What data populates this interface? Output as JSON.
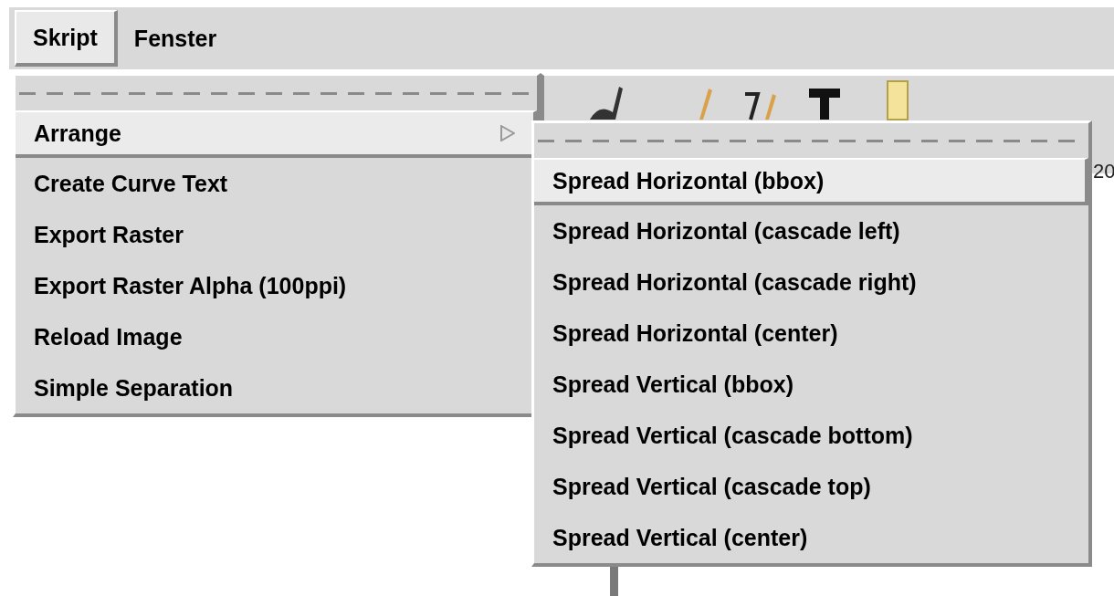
{
  "menubar": [
    {
      "label": "Skript",
      "selected": true
    },
    {
      "label": "Fenster",
      "selected": false
    }
  ],
  "menu": {
    "tear_off": true,
    "items": [
      {
        "label": "Arrange",
        "selected": true,
        "submenu": true
      },
      {
        "label": "Create Curve Text",
        "selected": false,
        "submenu": false
      },
      {
        "label": "Export Raster",
        "selected": false,
        "submenu": false
      },
      {
        "label": "Export Raster Alpha (100ppi)",
        "selected": false,
        "submenu": false
      },
      {
        "label": "Reload Image",
        "selected": false,
        "submenu": false
      },
      {
        "label": "Simple Separation",
        "selected": false,
        "submenu": false
      }
    ]
  },
  "submenu": {
    "tear_off": true,
    "items": [
      {
        "label": "Spread Horizontal (bbox)",
        "selected": true
      },
      {
        "label": "Spread Horizontal (cascade left)",
        "selected": false
      },
      {
        "label": "Spread Horizontal (cascade right)",
        "selected": false
      },
      {
        "label": "Spread Horizontal (center)",
        "selected": false
      },
      {
        "label": "Spread Vertical (bbox)",
        "selected": false
      },
      {
        "label": "Spread Vertical (cascade bottom)",
        "selected": false
      },
      {
        "label": "Spread Vertical (cascade top)",
        "selected": false
      },
      {
        "label": "Spread Vertical (center)",
        "selected": false
      }
    ]
  },
  "background": {
    "field_text": "20"
  }
}
